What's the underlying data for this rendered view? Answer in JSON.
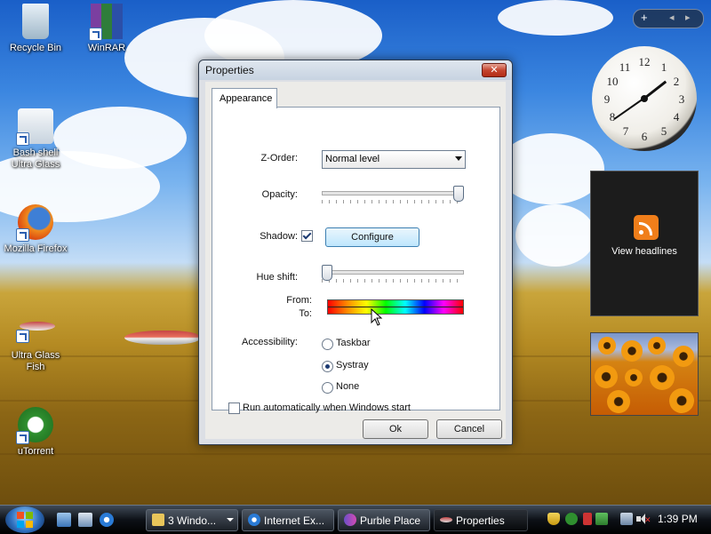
{
  "desktop_icons": [
    {
      "label": "Recycle Bin"
    },
    {
      "label": "WinRAR"
    },
    {
      "label": "Bash shell Ultra Glass"
    },
    {
      "label": "Mozilla Firefox"
    },
    {
      "label": "Ultra Glass Fish"
    },
    {
      "label": "uTorrent"
    }
  ],
  "gadgets": {
    "controls": {
      "add": "+",
      "prev": "◂",
      "next": "▸"
    },
    "clock_numbers": [
      "12",
      "1",
      "2",
      "3",
      "4",
      "5",
      "6",
      "7",
      "8",
      "9",
      "10",
      "11"
    ],
    "feed_label": "View headlines"
  },
  "dialog": {
    "title": "Properties",
    "close": "✕",
    "tab": "Appearance",
    "z_order_label": "Z-Order:",
    "z_order_value": "Normal level",
    "opacity_label": "Opacity:",
    "opacity_value": 1.0,
    "shadow_label": "Shadow:",
    "shadow_checked": true,
    "configure_button": "Configure",
    "hue_shift_label": "Hue shift:",
    "hue_shift_value": 0.0,
    "from_label": "From:",
    "to_label": "To:",
    "accessibility_label": "Accessibility:",
    "accessibility_options": [
      "Taskbar",
      "Systray",
      "None"
    ],
    "accessibility_selected": "Systray",
    "run_auto_label": "Run automatically when Windows start",
    "run_auto_checked": false,
    "ok_button": "Ok",
    "cancel_button": "Cancel"
  },
  "taskbar": {
    "buttons": [
      {
        "label": "3 Windo..."
      },
      {
        "label": "Internet Ex..."
      },
      {
        "label": "Purble Place"
      },
      {
        "label": "Properties"
      }
    ],
    "time": "1:39 PM"
  }
}
